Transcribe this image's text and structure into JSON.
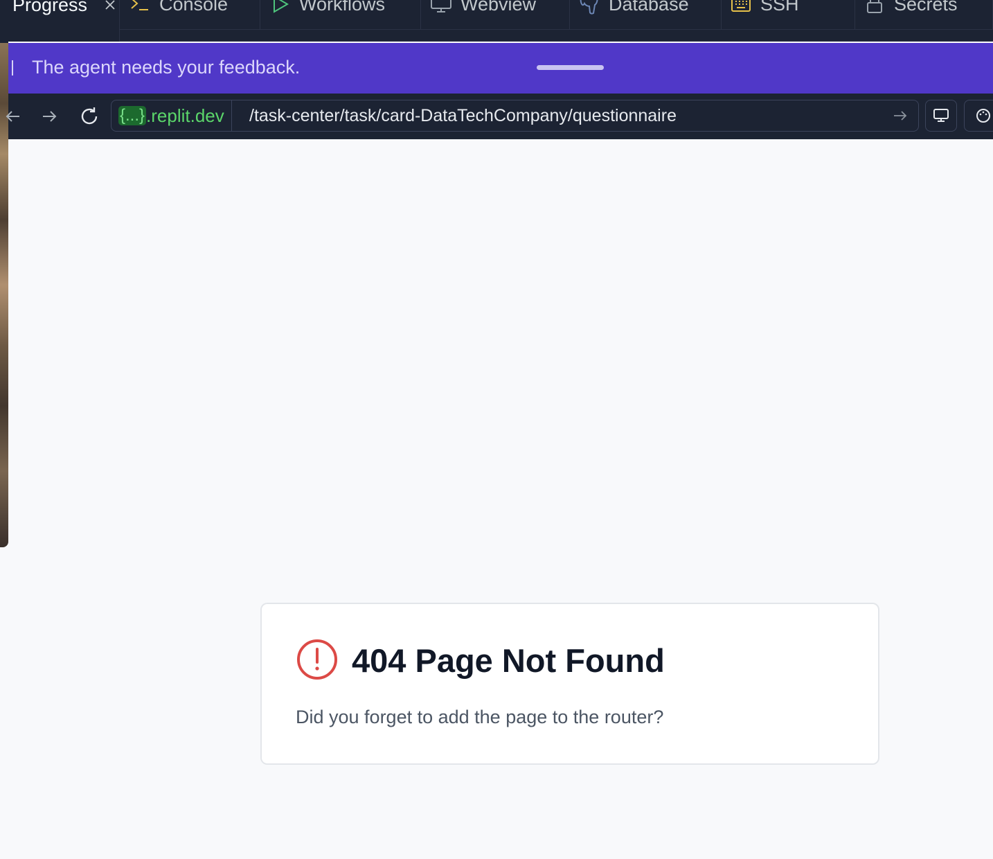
{
  "tabs": [
    {
      "label": "Progress",
      "icon": "none",
      "active": true
    },
    {
      "label": "Console",
      "icon": "console-icon"
    },
    {
      "label": "Workflows",
      "icon": "play-icon"
    },
    {
      "label": "Webview",
      "icon": "monitor-icon"
    },
    {
      "label": "Database",
      "icon": "postgres-icon"
    },
    {
      "label": "SSH",
      "icon": "keyboard-icon"
    },
    {
      "label": "Secrets",
      "icon": "lock-icon"
    }
  ],
  "banner": {
    "text": "The agent needs your feedback.",
    "color": "#5038c8"
  },
  "url": {
    "host_prefix": "{...}",
    "host_suffix": ".replit.dev",
    "path": "/task-center/task/card-DataTechCompany/questionnaire"
  },
  "error": {
    "title": "404 Page Not Found",
    "message": "Did you forget to add the page to the router?",
    "icon": "alert-circle-icon",
    "icon_color": "#dc4a46"
  }
}
